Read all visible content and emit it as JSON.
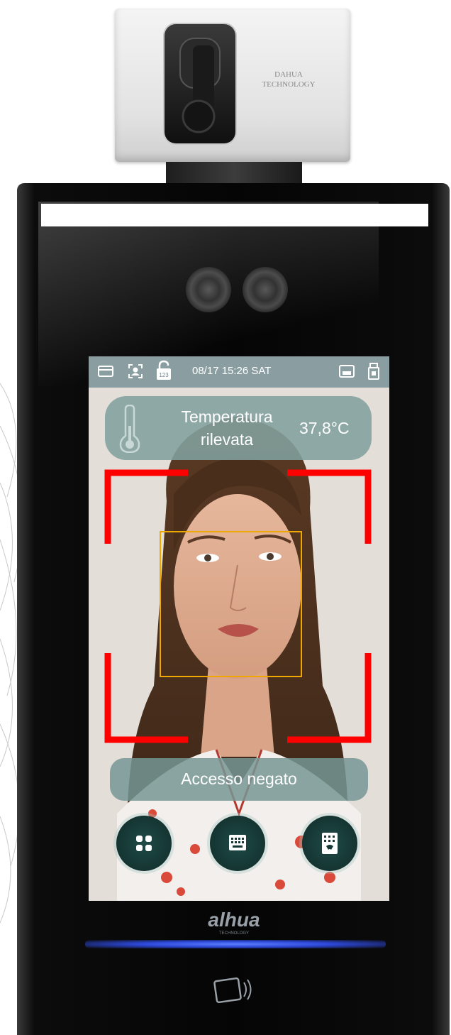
{
  "camera": {
    "brand_line_1": "DAHUA",
    "brand_line_2": "TECHNOLOGY"
  },
  "status_bar": {
    "datetime": "08/17 15:26 SAT",
    "icons": [
      "card-icon",
      "face-icon",
      "password-unlock-icon",
      "network-icon",
      "usb-icon"
    ],
    "password_icon_label": "123"
  },
  "temperature": {
    "label_line_1": "Temperatura",
    "label_line_2": "rilevata",
    "value": "37,8°C"
  },
  "result": {
    "text": "Accesso negato"
  },
  "actions": [
    {
      "icon": "menu-grid-icon"
    },
    {
      "icon": "keypad-icon"
    },
    {
      "icon": "call-keypad-icon"
    }
  ],
  "device": {
    "brand_logo": "alhua",
    "brand_tagline": "TECHNOLOGY"
  },
  "colors": {
    "status_bar": "#8a9ea2",
    "panel": "#82a09e",
    "face_frame": "#ff0000",
    "face_box": "#f0a800",
    "button": "#163835",
    "led": "#2d48d8"
  }
}
